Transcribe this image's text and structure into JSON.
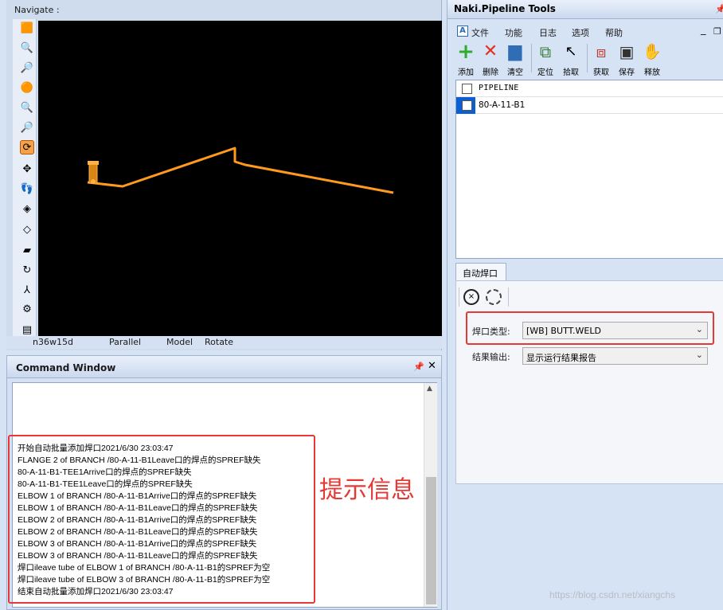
{
  "navigate": {
    "title": "Navigate :",
    "status": {
      "view_name": "n36w15d",
      "projection": "Parallel",
      "mode": "Model",
      "action": "Rotate"
    }
  },
  "toolbar_icons": [
    "zoom-window-icon",
    "zoom-in-icon",
    "zoom-out-icon",
    "walk-icon",
    "zoom-extents-icon",
    "zoom-icon",
    "rotate-icon",
    "pan-icon",
    "footsteps-icon",
    "layers-icon",
    "clip-icon",
    "section-icon",
    "refresh-icon",
    "axes-icon",
    "settings-icon",
    "display-icon"
  ],
  "pipe_color": "#ff9a1e",
  "command_window": {
    "title": "Command Window",
    "lines": [
      "开始自动批量添加焊口2021/6/30 23:03:47",
      "FLANGE 2 of BRANCH /80-A-11-B1Leave口的焊点的SPREF缺失",
      "80-A-11-B1-TEE1Arrive口的焊点的SPREF缺失",
      "80-A-11-B1-TEE1Leave口的焊点的SPREF缺失",
      "ELBOW 1 of BRANCH /80-A-11-B1Arrive口的焊点的SPREF缺失",
      "ELBOW 1 of BRANCH /80-A-11-B1Leave口的焊点的SPREF缺失",
      "ELBOW 2 of BRANCH /80-A-11-B1Arrive口的焊点的SPREF缺失",
      "ELBOW 2 of BRANCH /80-A-11-B1Leave口的焊点的SPREF缺失",
      "ELBOW 3 of BRANCH /80-A-11-B1Arrive口的焊点的SPREF缺失",
      "ELBOW 3 of BRANCH /80-A-11-B1Leave口的焊点的SPREF缺失",
      "焊口ileave tube of ELBOW 1 of BRANCH /80-A-11-B1的SPREF为空",
      "焊口ileave tube of ELBOW 3 of BRANCH /80-A-11-B1的SPREF为空",
      "结束自动批量添加焊口2021/6/30 23:03:47"
    ],
    "annotation": "提示信息"
  },
  "tools": {
    "title": "Naki.Pipeline Tools",
    "menu": [
      "文件",
      "功能",
      "日志",
      "选项",
      "帮助"
    ],
    "buttons": [
      {
        "label": "添加",
        "icon": "plus-icon"
      },
      {
        "label": "删除",
        "icon": "delete-x-icon"
      },
      {
        "label": "清空",
        "icon": "trash-icon"
      },
      {
        "label": "定位",
        "icon": "locate-icon"
      },
      {
        "label": "拾取",
        "icon": "pointer-icon"
      },
      {
        "label": "获取",
        "icon": "fetch-icon"
      },
      {
        "label": "保存",
        "icon": "save-icon"
      },
      {
        "label": "释放",
        "icon": "hand-icon"
      }
    ],
    "list": {
      "header": "PIPELINE",
      "rows": [
        "80-A-11-B1"
      ]
    },
    "weld_tab": "自动焊口",
    "weld_type_label": "焊口类型:",
    "weld_type_value": "[WB] BUTT.WELD",
    "output_label": "结果输出:",
    "output_value": "显示运行结果报告"
  },
  "watermark": "https://blog.csdn.net/xiangchs"
}
